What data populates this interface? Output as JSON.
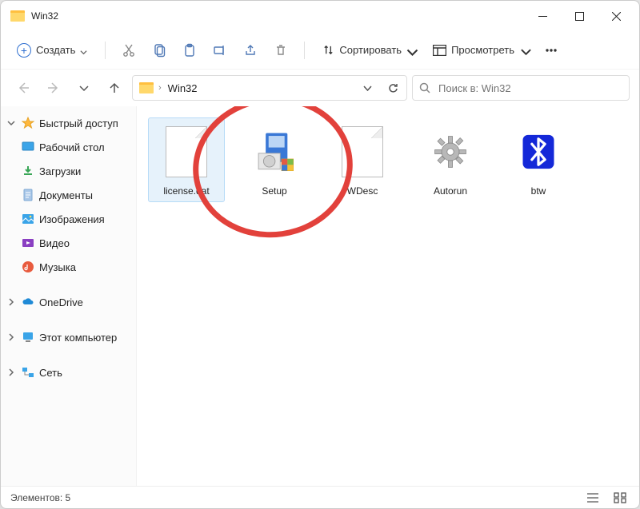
{
  "window": {
    "title": "Win32"
  },
  "toolbar": {
    "create_label": "Создать",
    "sort_label": "Сортировать",
    "view_label": "Просмотреть"
  },
  "address": {
    "crumb": "Win32"
  },
  "search": {
    "placeholder": "Поиск в: Win32"
  },
  "sidebar": {
    "quick_access": "Быстрый доступ",
    "desktop": "Рабочий стол",
    "downloads": "Загрузки",
    "documents": "Документы",
    "pictures": "Изображения",
    "videos": "Видео",
    "music": "Музыка",
    "onedrive": "OneDrive",
    "this_pc": "Этот компьютер",
    "network": "Сеть"
  },
  "files": [
    {
      "name": "license.dat",
      "icon": "blank-file",
      "selected": true
    },
    {
      "name": "Setup",
      "icon": "installer",
      "selected": false
    },
    {
      "name": "WDesc",
      "icon": "blank-file",
      "selected": false
    },
    {
      "name": "Autorun",
      "icon": "gear-file",
      "selected": false
    },
    {
      "name": "btw",
      "icon": "bluetooth",
      "selected": false
    }
  ],
  "status": {
    "elements_label": "Элементов: 5"
  },
  "annotation": {
    "highlight_color": "#e2413b"
  }
}
